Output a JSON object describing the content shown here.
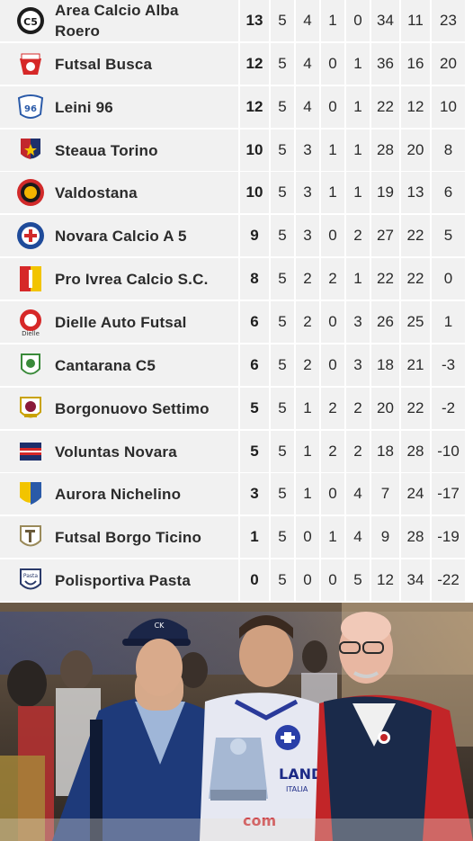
{
  "standings": {
    "rows": [
      {
        "team": "Area Calcio Alba Roero",
        "logo": "area-calcio-alba-roero-logo",
        "values": [
          "13",
          "5",
          "4",
          "1",
          "0",
          "34",
          "11",
          "23"
        ]
      },
      {
        "team": "Futsal Busca",
        "logo": "futsal-busca-logo",
        "values": [
          "12",
          "5",
          "4",
          "0",
          "1",
          "36",
          "16",
          "20"
        ]
      },
      {
        "team": "Leini 96",
        "logo": "leini-96-logo",
        "values": [
          "12",
          "5",
          "4",
          "0",
          "1",
          "22",
          "12",
          "10"
        ]
      },
      {
        "team": "Steaua Torino",
        "logo": "steaua-torino-logo",
        "values": [
          "10",
          "5",
          "3",
          "1",
          "1",
          "28",
          "20",
          "8"
        ]
      },
      {
        "team": "Valdostana",
        "logo": "valdostana-logo",
        "values": [
          "10",
          "5",
          "3",
          "1",
          "1",
          "19",
          "13",
          "6"
        ]
      },
      {
        "team": "Novara Calcio A 5",
        "logo": "novara-calcio-logo",
        "values": [
          "9",
          "5",
          "3",
          "0",
          "2",
          "27",
          "22",
          "5"
        ]
      },
      {
        "team": "Pro Ivrea Calcio S.C.",
        "logo": "pro-ivrea-logo",
        "values": [
          "8",
          "5",
          "2",
          "2",
          "1",
          "22",
          "22",
          "0"
        ]
      },
      {
        "team": "Dielle Auto Futsal",
        "logo": "dielle-auto-futsal-logo",
        "values": [
          "6",
          "5",
          "2",
          "0",
          "3",
          "26",
          "25",
          "1"
        ]
      },
      {
        "team": "Cantarana C5",
        "logo": "cantarana-logo",
        "values": [
          "6",
          "5",
          "2",
          "0",
          "3",
          "18",
          "21",
          "-3"
        ]
      },
      {
        "team": "Borgonuovo Settimo",
        "logo": "borgonuovo-settimo-logo",
        "values": [
          "5",
          "5",
          "1",
          "2",
          "2",
          "20",
          "22",
          "-2"
        ]
      },
      {
        "team": "Voluntas Novara",
        "logo": "voluntas-novara-logo",
        "values": [
          "5",
          "5",
          "1",
          "2",
          "2",
          "18",
          "28",
          "-10"
        ]
      },
      {
        "team": "Aurora Nichelino",
        "logo": "aurora-nichelino-logo",
        "values": [
          "3",
          "5",
          "1",
          "0",
          "4",
          "7",
          "24",
          "-17"
        ]
      },
      {
        "team": "Futsal Borgo Ticino",
        "logo": "futsal-borgo-ticino-logo",
        "values": [
          "1",
          "5",
          "0",
          "1",
          "4",
          "9",
          "28",
          "-19"
        ]
      },
      {
        "team": "Polisportiva Pasta",
        "logo": "polisportiva-pasta-logo",
        "values": [
          "0",
          "5",
          "0",
          "0",
          "5",
          "12",
          "34",
          "-22"
        ]
      }
    ]
  },
  "logo_text": {
    "area-calcio-alba-roero-logo": "C5",
    "leini-96-logo": "96",
    "dielle-auto-futsal-logo": "Dielle",
    "polisportiva-pasta-logo": "Pasta"
  },
  "photo": {
    "cap_text": "CK",
    "shirt_brand": "LAND",
    "shirt_sub": "ITALIA",
    "sponsor": "com"
  },
  "colors": {
    "row_bg": "#f1f1f1",
    "separator": "#ffffff",
    "text": "#2b2b2b"
  }
}
